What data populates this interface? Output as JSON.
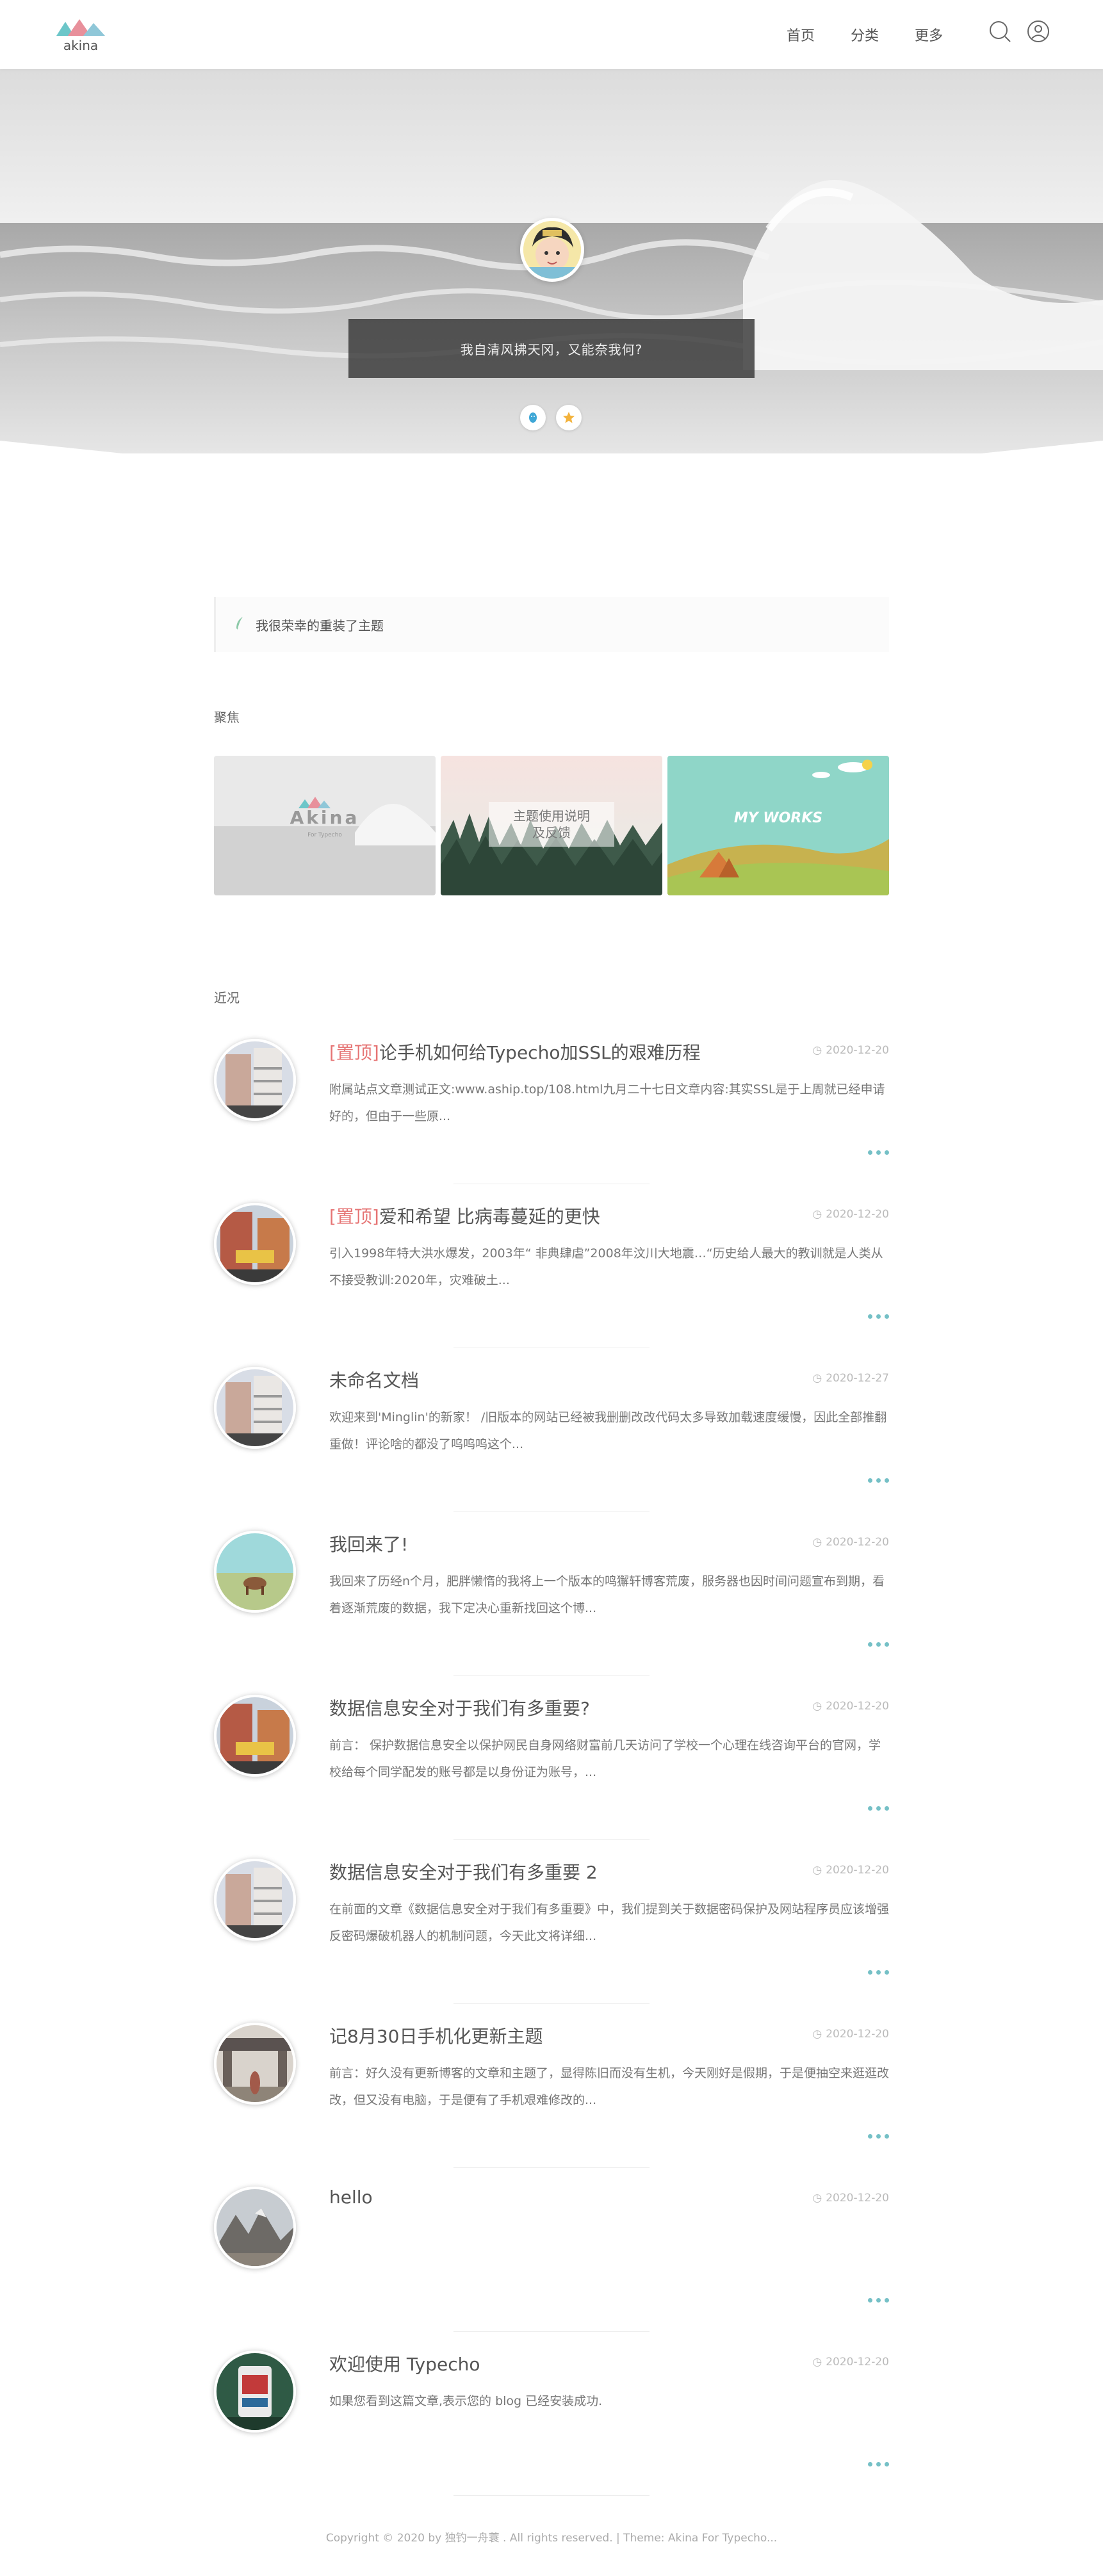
{
  "header": {
    "logo_text": "akina",
    "nav": [
      "首页",
      "分类",
      "更多"
    ]
  },
  "hero": {
    "quote": "我自清风拂天冈，又能奈我何?"
  },
  "notice": {
    "text": "我很荣幸的重装了主题"
  },
  "sections": {
    "focus": "聚焦",
    "recent": "近况"
  },
  "features": [
    {
      "title": "Akina",
      "subtitle": "For Typecho"
    },
    {
      "title": "主题使用说明",
      "subtitle": "及反馈"
    },
    {
      "title": "MY WORKS"
    }
  ],
  "posts": [
    {
      "pin": "[置顶]",
      "title": "论手机如何给Typecho加SSL的艰难历程",
      "date": "2020-12-20",
      "excerpt": "附属站点文章测试正文:www.aship.top/108.html九月二十七日文章内容:其实SSL是于上周就已经申请好的，但由于一些原..."
    },
    {
      "pin": "[置顶]",
      "title": "爱和希望 比病毒蔓延的更快",
      "date": "2020-12-20",
      "excerpt": "引入1998年特大洪水爆发，2003年“ 非典肆虐”2008年汶川大地震…“历史给人最大的教训就是人类从不接受教训:2020年，灾难破土..."
    },
    {
      "pin": "",
      "title": "未命名文档",
      "date": "2020-12-27",
      "excerpt": "欢迎来到'Minglin'的新家！ /旧版本的网站已经被我删删改改代码太多导致加载速度缓慢，因此全部推翻重做！评论啥的都没了呜呜呜这个..."
    },
    {
      "pin": "",
      "title": "我回来了!",
      "date": "2020-12-20",
      "excerpt": "我回来了历经n个月，肥胖懒惰的我将上一个版本的鸣獬轩博客荒废，服务器也因时间问题宣布到期，看着逐渐荒废的数据，我下定决心重新找回这个博..."
    },
    {
      "pin": "",
      "title": "数据信息安全对于我们有多重要?",
      "date": "2020-12-20",
      "excerpt": "前言： 保护数据信息安全以保护网民自身网络财富前几天访问了学校一个心理在线咨询平台的官网，学校给每个同学配发的账号都是以身份证为账号，..."
    },
    {
      "pin": "",
      "title": "数据信息安全对于我们有多重要 2",
      "date": "2020-12-20",
      "excerpt": "在前面的文章《数据信息安全对于我们有多重要》中，我们提到关于数据密码保护及网站程序员应该增强反密码爆破机器人的机制问题，今天此文将详细..."
    },
    {
      "pin": "",
      "title": "记8月30日手机化更新主题",
      "date": "2020-12-20",
      "excerpt": "前言：好久没有更新博客的文章和主题了，显得陈旧而没有生机，今天刚好是假期，于是便抽空来逛逛改改，但又没有电脑，于是便有了手机艰难修改的..."
    },
    {
      "pin": "",
      "title": "hello",
      "date": "2020-12-20",
      "excerpt": ""
    },
    {
      "pin": "",
      "title": "欢迎使用 Typecho",
      "date": "2020-12-20",
      "excerpt": "如果您看到这篇文章,表示您的 blog 已经安装成功."
    }
  ],
  "footer": {
    "text": "Copyright © 2020 by 独钓一舟蓑 . All rights reserved. | Theme: Akina For Typecho..."
  }
}
